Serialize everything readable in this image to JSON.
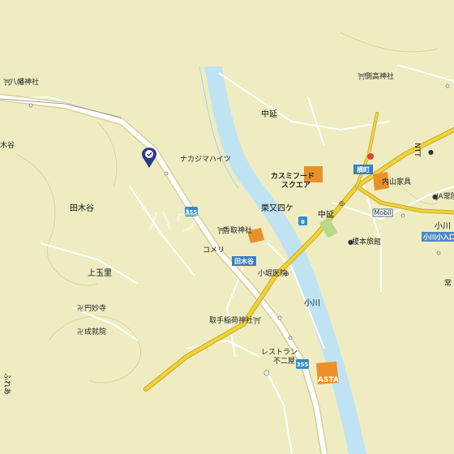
{
  "map": {
    "labels": {
      "hachiman": "八幡神社",
      "ki_tani": "木谷",
      "nakajima": "ナカジマハイツ",
      "katori": "香取神社",
      "komeri": "コメリ",
      "tagiya1": "田木谷",
      "tagiya2": "田木谷",
      "kamitamari": "上玉里",
      "emmyoji": "円妙寺",
      "joshuin": "成就院",
      "furea": "ふれあ",
      "kusunoki": "取手稲荷神社",
      "restaurant1": "レストラン",
      "restaurant2": "不二屋",
      "asta": "ASTA",
      "ogawa_clinic": "小堀医院",
      "ogawa": "小川",
      "kasumi1": "カスミフード",
      "kasumi2": "スクエア",
      "kurimata": "栗又四ケ",
      "nakanobe1": "中延",
      "nakanobe2": "中延",
      "yokomachi": "横町",
      "uchiyama": "内山家具",
      "enomoto": "榎本旅館",
      "ja": "JA常陸",
      "ntt": "NTT",
      "sokodaka": "側高神社",
      "mobil": "Mobil",
      "ogawa_area": "小川",
      "ogawa_iriguchi": "小川小入口",
      "tsune": "常",
      "route355a": "355",
      "route355b": "355",
      "route8": "8",
      "ogawa_tagiya_sign": "田木谷",
      "watermark": "ハウ"
    },
    "colors": {
      "base": "#efecc2",
      "river": "#bfe3f3",
      "road_main": "#ffffff",
      "road_yellow": "#f1d23c",
      "route_shield": "#2e8fc9",
      "poi_orange": "#e8912a",
      "sign_blue": "#3a7fc1"
    },
    "pin": {
      "icon": "location-pin-icon"
    }
  }
}
